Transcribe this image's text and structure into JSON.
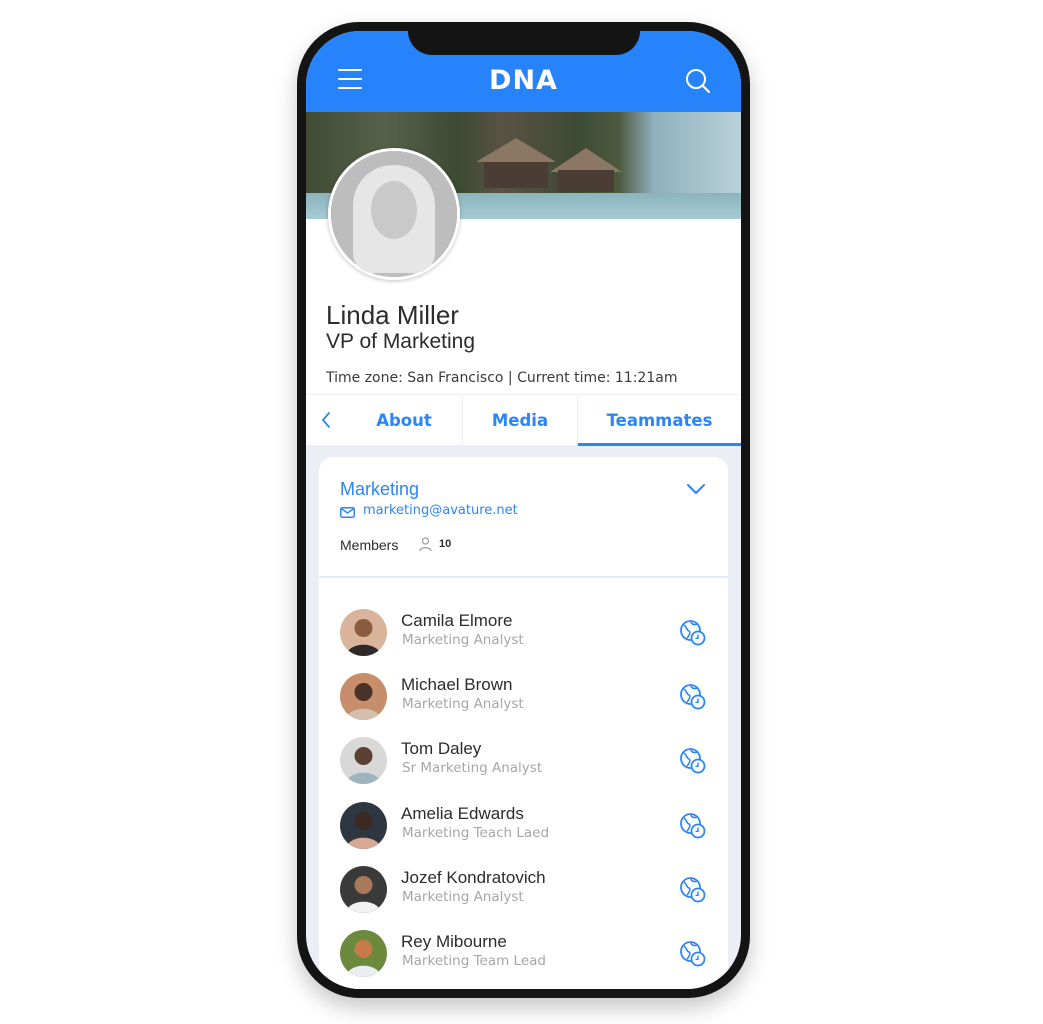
{
  "app": {
    "title": "DNA",
    "accent_color": "#2683fb",
    "menu_icon": "hamburger-menu-icon",
    "search_icon": "search-icon"
  },
  "profile": {
    "name": "Linda Miller",
    "title": "VP of Marketing",
    "timezone_line": "Time zone: San Francisco | Current time: 11:21am"
  },
  "tabs": {
    "back_icon": "chevron-left-icon",
    "items": [
      {
        "label": "About",
        "active": false
      },
      {
        "label": "Media",
        "active": false
      },
      {
        "label": "Teammates",
        "active": true
      }
    ]
  },
  "group": {
    "name": "Marketing",
    "email": "marketing@avature.net",
    "members_label": "Members",
    "members_count": "10",
    "expand_icon": "chevron-down-icon"
  },
  "members": [
    {
      "name": "Camila Elmore",
      "role": "Marketing Analyst",
      "avatar_colors": [
        "#d9b49a",
        "#8a5b3c",
        "#2e2a28"
      ]
    },
    {
      "name": "Michael Brown",
      "role": "Marketing Analyst",
      "avatar_colors": [
        "#c78e6c",
        "#4a3328",
        "#d4bfae"
      ]
    },
    {
      "name": "Tom Daley",
      "role": "Sr Marketing Analyst",
      "avatar_colors": [
        "#d8d8d8",
        "#5b4034",
        "#9fb3bf"
      ]
    },
    {
      "name": "Amelia Edwards",
      "role": "Marketing Teach Laed",
      "avatar_colors": [
        "#2e3642",
        "#3b2a22",
        "#d9a892"
      ]
    },
    {
      "name": "Jozef Kondratovich",
      "role": "Marketing Analyst",
      "avatar_colors": [
        "#3a3a3a",
        "#a9785a",
        "#f1f1f1"
      ]
    },
    {
      "name": "Rey Mibourne",
      "role": "Marketing Team Lead",
      "avatar_colors": [
        "#6b8a3e",
        "#c97a4a",
        "#e8eef2"
      ]
    }
  ]
}
